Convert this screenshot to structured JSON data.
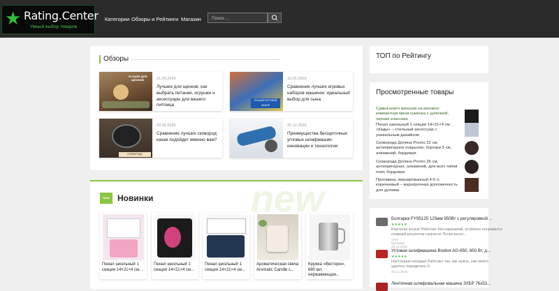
{
  "header": {
    "logo_name": "Rating.Center",
    "logo_tagline": "Умный выбор товаров",
    "nav": [
      "Категории",
      "Обзоры и Рейтинги",
      "Магазин"
    ],
    "search_placeholder": "Поиск ..."
  },
  "reviews": {
    "title": "Обзоры",
    "cards": [
      {
        "date": "21.05.2026",
        "text": "Лучшее для щенков: как выбрать питание, игрушки и аксессуары для вашего питомца",
        "thumb_caption": "ЛУЧШЕЕ ДЛЯ ЩЕНКОВ"
      },
      {
        "date": "16.05.2026",
        "text": "Сравнение лучших игровых наборов машинок: идеальный выбор для сына",
        "thumb_caption": "ЛУЧШИЙ ИГРОВОЙ НАБОР"
      },
      {
        "date": "03.05.2026",
        "text": "Сравнение лучших сковород: какая подойдет именно вам?",
        "thumb_caption": "СКОВОРОДА"
      },
      {
        "date": "20.12.2025",
        "text": "Преимущества бесщеточных угловых шлифмашин: инновации и технологии",
        "thumb_caption": ""
      }
    ]
  },
  "new_items": {
    "title": "Новинки",
    "badge": "NEW",
    "watermark": "new",
    "products": [
      "Пенал школьный 1 секция 14×21×4 см...",
      "Пенал школьный 1 секция 14×21×4 см...",
      "Пенал школьный 1 секция 14×21×4 см...",
      "Ароматическая свеча Aromatic Candle с...",
      "Кружка «Вестерн», 680 мл, нержавеющая..."
    ]
  },
  "sidebar": {
    "top_title": "ТОП по Рейтингу",
    "viewed_title": "Просмотренные товары",
    "viewed": [
      "Сумка-клатч женская на магните: компактная мини-сумочка с цепочкой, черная классика",
      "Пенал школьный 1 секция 14×21×4 см «Кеды» – стильный аксессуар с уникальным дизайном",
      "Сковорода Доляна Promo 22 см, антипригарное покрытие, бортики 5 см, алюминий, бордовая",
      "Сковорода Доляна Promo 26 см, антипригарная, алюминий, для всех типов плит, бордовая",
      "Противень эмалированный 4-5 л, коричневый – жаропрочная долговечность для духовки"
    ],
    "recent_reviews": [
      {
        "title": "Болгарка FY95125 125мм 950Вт с регулировкой ...",
        "stars": "★★★★★",
        "text": "Классная штука! Работает без нареканий, особенно понравился плавный регулятор скорости. Ручка регул...",
        "meta": "Олег Булгаков · 25.12.2025"
      },
      {
        "title": "Угловая шлифмашина Boxbot AG-650, 650 Вт, д...",
        "stars": "★★★★★",
        "text": "Настоящая находка! Работает так, как нужно, уже много удалось переделать б...",
        "meta": "25.12.2025"
      },
      {
        "title": "Ленточная шлифовальная машина ЗУБР 76х53...",
        "stars": "",
        "text": "",
        "meta": ""
      }
    ]
  },
  "colors": {
    "accent": "#8ac53f",
    "header_bg": "#2b2b2b",
    "logo_green": "#2fbf3a"
  }
}
